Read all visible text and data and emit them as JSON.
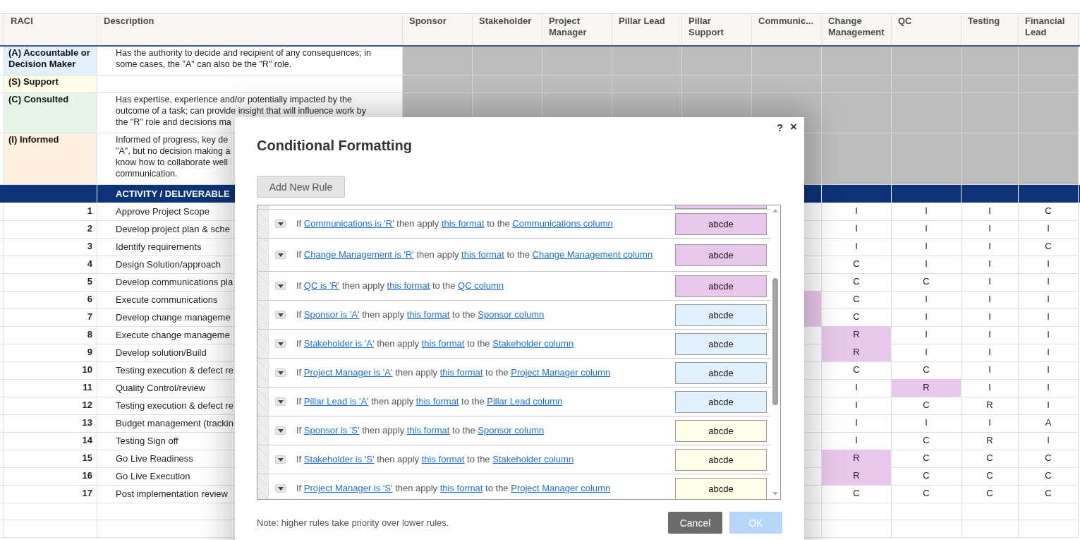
{
  "sheet": {
    "columns": [
      "RACI",
      "Description",
      "Sponsor",
      "Stakeholder",
      "Project Manager",
      "Pillar Lead",
      "Pillar Support",
      "Communic...",
      "Change Management",
      "QC",
      "Testing",
      "Financial Lead"
    ],
    "raci_rows": [
      {
        "label": "(A) Accountable or Decision Maker",
        "color": "#e1effd",
        "lines": [
          "Has the authority to decide and recipient of any consequences; in",
          "some cases, the \"A\" can also be the \"R\" role."
        ]
      },
      {
        "label": "(S) Support",
        "color": "#fffde6",
        "lines": []
      },
      {
        "label": "(C) Consulted",
        "color": "#e6f4e8",
        "lines": [
          "Has expertise, experience and/or potentially impacted by the",
          "outcome of a task; can provide insight that will influence work by",
          "the \"R\" role and decisions ma"
        ]
      },
      {
        "label": "(I) Informed",
        "color": "#fdf0de",
        "lines": [
          "Informed of progress, key de",
          "\"A\", but no decision making a",
          "know how to collaborate well",
          "communication."
        ]
      }
    ],
    "activity_header": "ACTIVITY / DELIVERABLE",
    "activities": [
      {
        "num": "1",
        "activity": "Approve Project Scope",
        "communications_highlight": false,
        "cells": [
          {
            "text": "I",
            "highlight": false
          },
          {
            "text": "I",
            "highlight": false
          },
          {
            "text": "I",
            "highlight": false
          },
          {
            "text": "C",
            "highlight": false
          }
        ]
      },
      {
        "num": "2",
        "activity": "Develop project plan & sche",
        "communications_highlight": false,
        "cells": [
          {
            "text": "I",
            "highlight": false
          },
          {
            "text": "I",
            "highlight": false
          },
          {
            "text": "I",
            "highlight": false
          },
          {
            "text": "I",
            "highlight": false
          }
        ]
      },
      {
        "num": "3",
        "activity": "Identify requirements",
        "communications_highlight": false,
        "cells": [
          {
            "text": "I",
            "highlight": false
          },
          {
            "text": "I",
            "highlight": false
          },
          {
            "text": "I",
            "highlight": false
          },
          {
            "text": "C",
            "highlight": false
          }
        ]
      },
      {
        "num": "4",
        "activity": "Design Solution/approach",
        "communications_highlight": false,
        "cells": [
          {
            "text": "C",
            "highlight": false
          },
          {
            "text": "I",
            "highlight": false
          },
          {
            "text": "I",
            "highlight": false
          },
          {
            "text": "I",
            "highlight": false
          }
        ]
      },
      {
        "num": "5",
        "activity": "Develop communications pla",
        "communications_highlight": false,
        "cells": [
          {
            "text": "C",
            "highlight": false
          },
          {
            "text": "C",
            "highlight": false
          },
          {
            "text": "I",
            "highlight": false
          },
          {
            "text": "I",
            "highlight": false
          }
        ]
      },
      {
        "num": "6",
        "activity": "Execute communications",
        "communications_highlight": true,
        "cells": [
          {
            "text": "C",
            "highlight": false
          },
          {
            "text": "I",
            "highlight": false
          },
          {
            "text": "I",
            "highlight": false
          },
          {
            "text": "I",
            "highlight": false
          }
        ]
      },
      {
        "num": "7",
        "activity": "Develop change manageme",
        "communications_highlight": true,
        "cells": [
          {
            "text": "C",
            "highlight": false
          },
          {
            "text": "I",
            "highlight": false
          },
          {
            "text": "I",
            "highlight": false
          },
          {
            "text": "I",
            "highlight": false
          }
        ]
      },
      {
        "num": "8",
        "activity": "Execute change manageme",
        "communications_highlight": false,
        "cells": [
          {
            "text": "R",
            "highlight": true
          },
          {
            "text": "I",
            "highlight": false
          },
          {
            "text": "I",
            "highlight": false
          },
          {
            "text": "I",
            "highlight": false
          }
        ]
      },
      {
        "num": "9",
        "activity": "Develop solution/Build",
        "communications_highlight": false,
        "cells": [
          {
            "text": "R",
            "highlight": true
          },
          {
            "text": "I",
            "highlight": false
          },
          {
            "text": "I",
            "highlight": false
          },
          {
            "text": "I",
            "highlight": false
          }
        ]
      },
      {
        "num": "10",
        "activity": "Testing execution & defect re",
        "communications_highlight": false,
        "cells": [
          {
            "text": "C",
            "highlight": false
          },
          {
            "text": "C",
            "highlight": false
          },
          {
            "text": "I",
            "highlight": false
          },
          {
            "text": "I",
            "highlight": false
          }
        ]
      },
      {
        "num": "11",
        "activity": "Quality Control/review",
        "communications_highlight": false,
        "cells": [
          {
            "text": "I",
            "highlight": false
          },
          {
            "text": "R",
            "highlight": true
          },
          {
            "text": "I",
            "highlight": false
          },
          {
            "text": "I",
            "highlight": false
          }
        ]
      },
      {
        "num": "12",
        "activity": "Testing execution & defect re",
        "communications_highlight": false,
        "cells": [
          {
            "text": "I",
            "highlight": false
          },
          {
            "text": "C",
            "highlight": false
          },
          {
            "text": "R",
            "highlight": false
          },
          {
            "text": "I",
            "highlight": false
          }
        ]
      },
      {
        "num": "13",
        "activity": "Budget management (trackin",
        "communications_highlight": false,
        "cells": [
          {
            "text": "I",
            "highlight": false
          },
          {
            "text": "I",
            "highlight": false
          },
          {
            "text": "I",
            "highlight": false
          },
          {
            "text": "A",
            "highlight": false
          }
        ]
      },
      {
        "num": "14",
        "activity": "Testing Sign off",
        "communications_highlight": false,
        "cells": [
          {
            "text": "I",
            "highlight": false
          },
          {
            "text": "C",
            "highlight": false
          },
          {
            "text": "R",
            "highlight": false
          },
          {
            "text": "I",
            "highlight": false
          }
        ]
      },
      {
        "num": "15",
        "activity": "Go Live Readiness",
        "communications_highlight": false,
        "cells": [
          {
            "text": "R",
            "highlight": true
          },
          {
            "text": "C",
            "highlight": false
          },
          {
            "text": "C",
            "highlight": false
          },
          {
            "text": "C",
            "highlight": false
          }
        ]
      },
      {
        "num": "16",
        "activity": "Go Live Execution",
        "communications_highlight": false,
        "cells": [
          {
            "text": "R",
            "highlight": true
          },
          {
            "text": "C",
            "highlight": false
          },
          {
            "text": "C",
            "highlight": false
          },
          {
            "text": "C",
            "highlight": false
          }
        ]
      },
      {
        "num": "17",
        "activity": "Post implementation review",
        "communications_highlight": false,
        "cells": [
          {
            "text": "C",
            "highlight": false
          },
          {
            "text": "C",
            "highlight": false
          },
          {
            "text": "C",
            "highlight": false
          },
          {
            "text": "C",
            "highlight": false
          }
        ]
      }
    ]
  },
  "dialog": {
    "help": "?",
    "close": "×",
    "title": "Conditional Formatting",
    "add_button": "Add New Rule",
    "rules": [
      {
        "kind": "partial",
        "color": "#e9c7ec"
      },
      {
        "kind": "rule",
        "color": "#e9c7ec",
        "sample": "abcde",
        "parts": [
          {
            "kind": "text",
            "text": "If"
          },
          {
            "kind": "link",
            "text": "Communications is 'R'"
          },
          {
            "kind": "text",
            "text": "then apply"
          },
          {
            "kind": "link",
            "text": "this format"
          },
          {
            "kind": "text",
            "text": "to the"
          },
          {
            "kind": "link",
            "text": "Communications column"
          }
        ]
      },
      {
        "kind": "rule",
        "color": "#e9c7ec",
        "sample": "abcde",
        "parts": [
          {
            "kind": "text",
            "text": "If"
          },
          {
            "kind": "link",
            "text": "Change Management is 'R'"
          },
          {
            "kind": "text",
            "text": "then apply"
          },
          {
            "kind": "link",
            "text": "this format"
          },
          {
            "kind": "text",
            "text": "to the"
          },
          {
            "kind": "link",
            "text": "Change Management column"
          }
        ]
      },
      {
        "kind": "rule",
        "color": "#e9c7ec",
        "sample": "abcde",
        "parts": [
          {
            "kind": "text",
            "text": "If"
          },
          {
            "kind": "link",
            "text": "QC is 'R'"
          },
          {
            "kind": "text",
            "text": "then apply"
          },
          {
            "kind": "link",
            "text": "this format"
          },
          {
            "kind": "text",
            "text": "to the"
          },
          {
            "kind": "link",
            "text": "QC column"
          }
        ]
      },
      {
        "kind": "rule",
        "color": "#e1f0fd",
        "sample": "abcde",
        "parts": [
          {
            "kind": "text",
            "text": "If"
          },
          {
            "kind": "link",
            "text": "Sponsor is 'A'"
          },
          {
            "kind": "text",
            "text": "then apply"
          },
          {
            "kind": "link",
            "text": "this format"
          },
          {
            "kind": "text",
            "text": "to the"
          },
          {
            "kind": "link",
            "text": "Sponsor column"
          }
        ]
      },
      {
        "kind": "rule",
        "color": "#e1f0fd",
        "sample": "abcde",
        "parts": [
          {
            "kind": "text",
            "text": "If"
          },
          {
            "kind": "link",
            "text": "Stakeholder is 'A'"
          },
          {
            "kind": "text",
            "text": "then apply"
          },
          {
            "kind": "link",
            "text": "this format"
          },
          {
            "kind": "text",
            "text": "to the"
          },
          {
            "kind": "link",
            "text": "Stakeholder column"
          }
        ]
      },
      {
        "kind": "rule",
        "color": "#e1f0fd",
        "sample": "abcde",
        "parts": [
          {
            "kind": "text",
            "text": "If"
          },
          {
            "kind": "link",
            "text": "Project Manager is 'A'"
          },
          {
            "kind": "text",
            "text": "then apply"
          },
          {
            "kind": "link",
            "text": "this format"
          },
          {
            "kind": "text",
            "text": "to the"
          },
          {
            "kind": "link",
            "text": "Project Manager column"
          }
        ]
      },
      {
        "kind": "rule",
        "color": "#e1f0fd",
        "sample": "abcde",
        "parts": [
          {
            "kind": "text",
            "text": "If"
          },
          {
            "kind": "link",
            "text": "Pillar Lead is 'A'"
          },
          {
            "kind": "text",
            "text": "then apply"
          },
          {
            "kind": "link",
            "text": "this format"
          },
          {
            "kind": "text",
            "text": "to the"
          },
          {
            "kind": "link",
            "text": "Pillar Lead column"
          }
        ]
      },
      {
        "kind": "rule",
        "color": "#fefde8",
        "sample": "abcde",
        "parts": [
          {
            "kind": "text",
            "text": "If"
          },
          {
            "kind": "link",
            "text": "Sponsor is 'S'"
          },
          {
            "kind": "text",
            "text": "then apply"
          },
          {
            "kind": "link",
            "text": "this format"
          },
          {
            "kind": "text",
            "text": "to the"
          },
          {
            "kind": "link",
            "text": "Sponsor column"
          }
        ]
      },
      {
        "kind": "rule",
        "color": "#fefde8",
        "sample": "abcde",
        "parts": [
          {
            "kind": "text",
            "text": "If"
          },
          {
            "kind": "link",
            "text": "Stakeholder is 'S'"
          },
          {
            "kind": "text",
            "text": "then apply"
          },
          {
            "kind": "link",
            "text": "this format"
          },
          {
            "kind": "text",
            "text": "to the"
          },
          {
            "kind": "link",
            "text": "Stakeholder column"
          }
        ]
      },
      {
        "kind": "rule",
        "color": "#fefde8",
        "sample": "abcde",
        "parts": [
          {
            "kind": "text",
            "text": "If"
          },
          {
            "kind": "link",
            "text": "Project Manager is 'S'"
          },
          {
            "kind": "text",
            "text": "then apply"
          },
          {
            "kind": "link",
            "text": "this format"
          },
          {
            "kind": "text",
            "text": "to the"
          },
          {
            "kind": "link",
            "text": "Project Manager column"
          }
        ]
      }
    ],
    "note": "Note: higher rules take priority over lower rules.",
    "cancel_button": "Cancel",
    "ok_button": {
      "label": "OK",
      "disabled": true
    }
  }
}
